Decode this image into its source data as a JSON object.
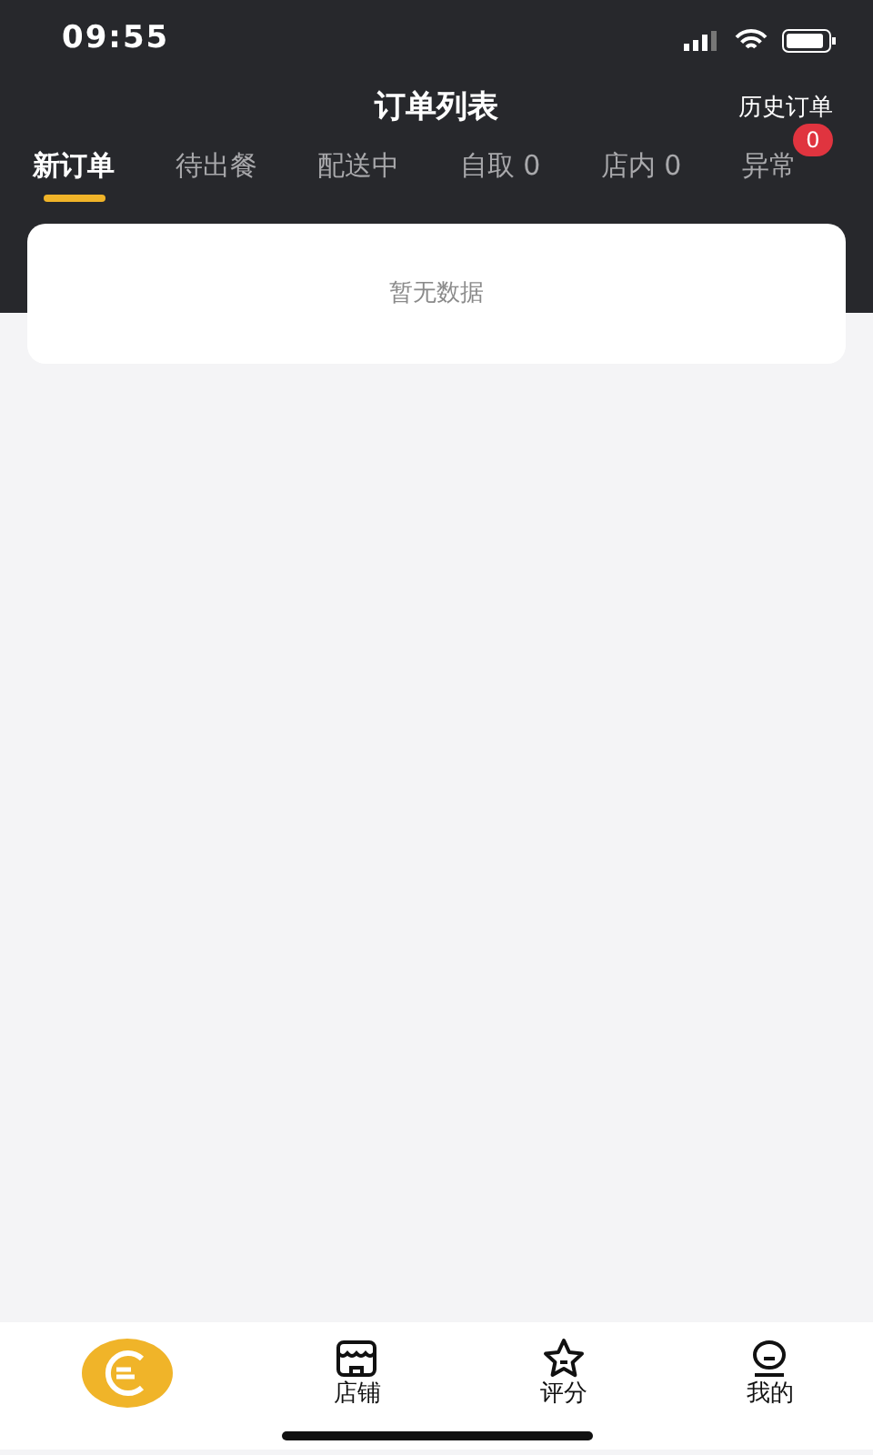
{
  "status_bar": {
    "time": "09:55"
  },
  "header": {
    "title": "订单列表",
    "action": "历史订单"
  },
  "tabs": [
    {
      "label": "新订单",
      "selected": true
    },
    {
      "label": "待出餐",
      "selected": false
    },
    {
      "label": "配送中",
      "selected": false
    },
    {
      "label": "自取 0",
      "selected": false
    },
    {
      "label": "店内 0",
      "selected": false
    },
    {
      "label": "异常",
      "selected": false,
      "badge": "0"
    }
  ],
  "empty_message": "暂无数据",
  "bottom_nav": [
    {
      "kind": "orders",
      "selected": true
    },
    {
      "kind": "store",
      "label": "店铺",
      "selected": false
    },
    {
      "kind": "rating",
      "label": "评分",
      "selected": false
    },
    {
      "kind": "profile",
      "label": "我的",
      "selected": false
    }
  ]
}
